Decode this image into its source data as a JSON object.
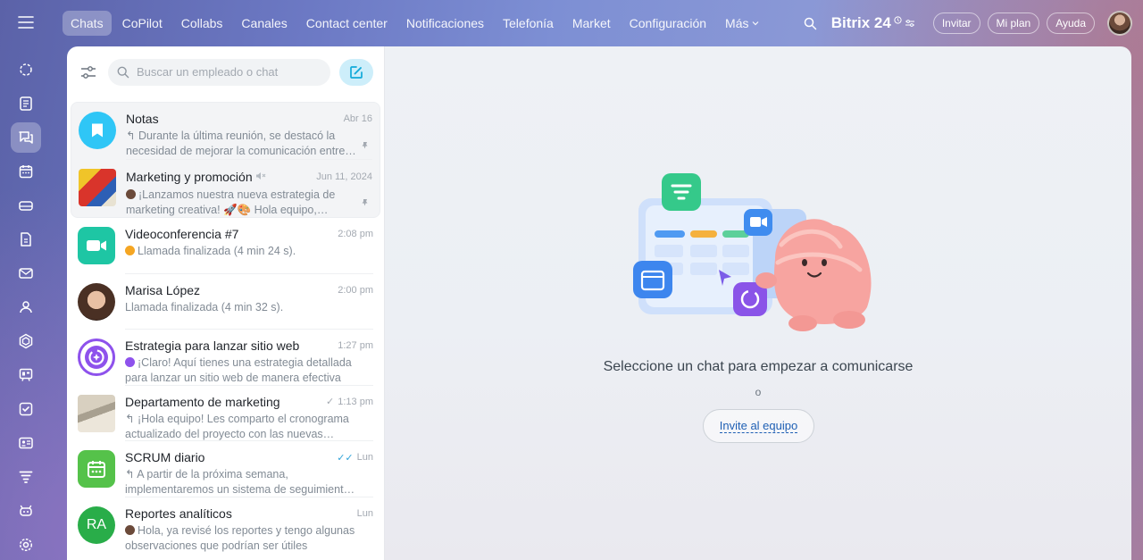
{
  "rail": {
    "items": [
      {
        "name": "feed-icon",
        "active": false
      },
      {
        "name": "tasks-doc-icon",
        "active": false
      },
      {
        "name": "messenger-icon",
        "active": true
      },
      {
        "name": "calendar-icon",
        "active": false
      },
      {
        "name": "drive-icon",
        "active": false
      },
      {
        "name": "document-icon",
        "active": false
      },
      {
        "name": "mail-icon",
        "active": false
      },
      {
        "name": "team-icon",
        "active": false
      },
      {
        "name": "hexagon-icon",
        "active": false
      },
      {
        "name": "board-icon",
        "active": false
      },
      {
        "name": "checkbox-icon",
        "active": false
      },
      {
        "name": "contact-card-icon",
        "active": false
      },
      {
        "name": "funnel-icon",
        "active": false
      },
      {
        "name": "robot-icon",
        "active": false
      },
      {
        "name": "settings-icon",
        "active": false
      }
    ]
  },
  "topnav": {
    "tabs": [
      "Chats",
      "CoPilot",
      "Collabs",
      "Canales",
      "Contact center",
      "Notificaciones",
      "Telefonía",
      "Market",
      "Configuración",
      "Más"
    ],
    "brand": "Bitrix 24",
    "invite": "Invitar",
    "plan": "Mi plan",
    "help": "Ayuda"
  },
  "chatlist": {
    "search_placeholder": "Buscar un empleado o chat",
    "pinned": [
      {
        "title": "Notas",
        "time": "Abr 16",
        "message": "Durante la última reunión, se destacó la necesidad de mejorar la comunicación entre los equipos",
        "avatar_color": "#2fc6f6"
      },
      {
        "title": "Marketing y promoción",
        "time": "Jun 11, 2024",
        "message": "¡Lanzamos nuestra nueva estrategia de marketing creativa! 🚀🎨 Hola equipo, estamos listos",
        "avatar_color": "#d9342b"
      }
    ],
    "chats": [
      {
        "title": "Videoconferencia #7",
        "time": "2:08 pm",
        "message": "Llamada finalizada (4 min 24 s).",
        "avatar_color": "#1ec6a4"
      },
      {
        "title": "Marisa López",
        "time": "2:00 pm",
        "message": "Llamada finalizada (4 min 32 s).",
        "avatar_color": "#6b4a3a"
      },
      {
        "title": "Estrategia para lanzar sitio web",
        "time": "1:27 pm",
        "message": "¡Claro! Aquí tienes una estrategia detallada para lanzar un sitio web de manera efectiva",
        "avatar_color": "#8e52ec"
      },
      {
        "title": "Departamento de marketing",
        "time": "1:13 pm",
        "message": "¡Hola equipo! Les comparto el cronograma actualizado del proyecto con las nuevas fechas",
        "avatar_color": "#c9b79c"
      },
      {
        "title": "SCRUM diario",
        "time": "Lun",
        "message": "A partir de la próxima semana, implementaremos un sistema de seguimiento diario",
        "avatar_color": "#55d0a0"
      },
      {
        "title": "Reportes analíticos",
        "time": "Lun",
        "message": "Hola, ya revisé los reportes y tengo algunas observaciones que podrían ser útiles",
        "avatar_color": "#29ad49",
        "initials": "RA"
      }
    ]
  },
  "main": {
    "empty_title": "Seleccione un chat para empezar a comunicarse",
    "or": "o",
    "invite_button": "Invite al equipo"
  }
}
